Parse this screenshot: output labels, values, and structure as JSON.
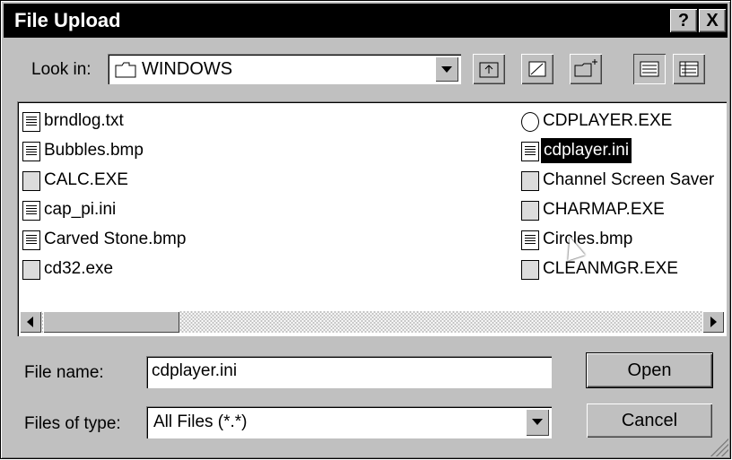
{
  "window": {
    "title": "File Upload",
    "help_label": "?",
    "close_label": "X"
  },
  "look_in": {
    "label": "Look in:",
    "value": "WINDOWS"
  },
  "toolbar": {
    "up_icon": "folder-up-icon",
    "desktop_icon": "desktop-icon",
    "new_folder_icon": "new-folder-icon",
    "list_icon": "list-view-icon",
    "details_icon": "details-view-icon"
  },
  "files": {
    "left": [
      {
        "name": "brndlog.txt",
        "icon": "txt"
      },
      {
        "name": "Bubbles.bmp",
        "icon": "bmp"
      },
      {
        "name": "CALC.EXE",
        "icon": "exe"
      },
      {
        "name": "cap_pi.ini",
        "icon": "ini"
      },
      {
        "name": "Carved Stone.bmp",
        "icon": "bmp"
      },
      {
        "name": "cd32.exe",
        "icon": "exe"
      }
    ],
    "right": [
      {
        "name": "CDPLAYER.EXE",
        "icon": "cd"
      },
      {
        "name": "cdplayer.ini",
        "icon": "ini",
        "selected": true
      },
      {
        "name": "Channel Screen Saver",
        "icon": "exe"
      },
      {
        "name": "CHARMAP.EXE",
        "icon": "exe"
      },
      {
        "name": "Circles.bmp",
        "icon": "bmp"
      },
      {
        "name": "CLEANMGR.EXE",
        "icon": "exe"
      }
    ]
  },
  "file_name": {
    "label": "File name:",
    "value": "cdplayer.ini"
  },
  "file_type": {
    "label": "Files of type:",
    "value": "All Files (*.*)"
  },
  "buttons": {
    "open": "Open",
    "cancel": "Cancel"
  }
}
